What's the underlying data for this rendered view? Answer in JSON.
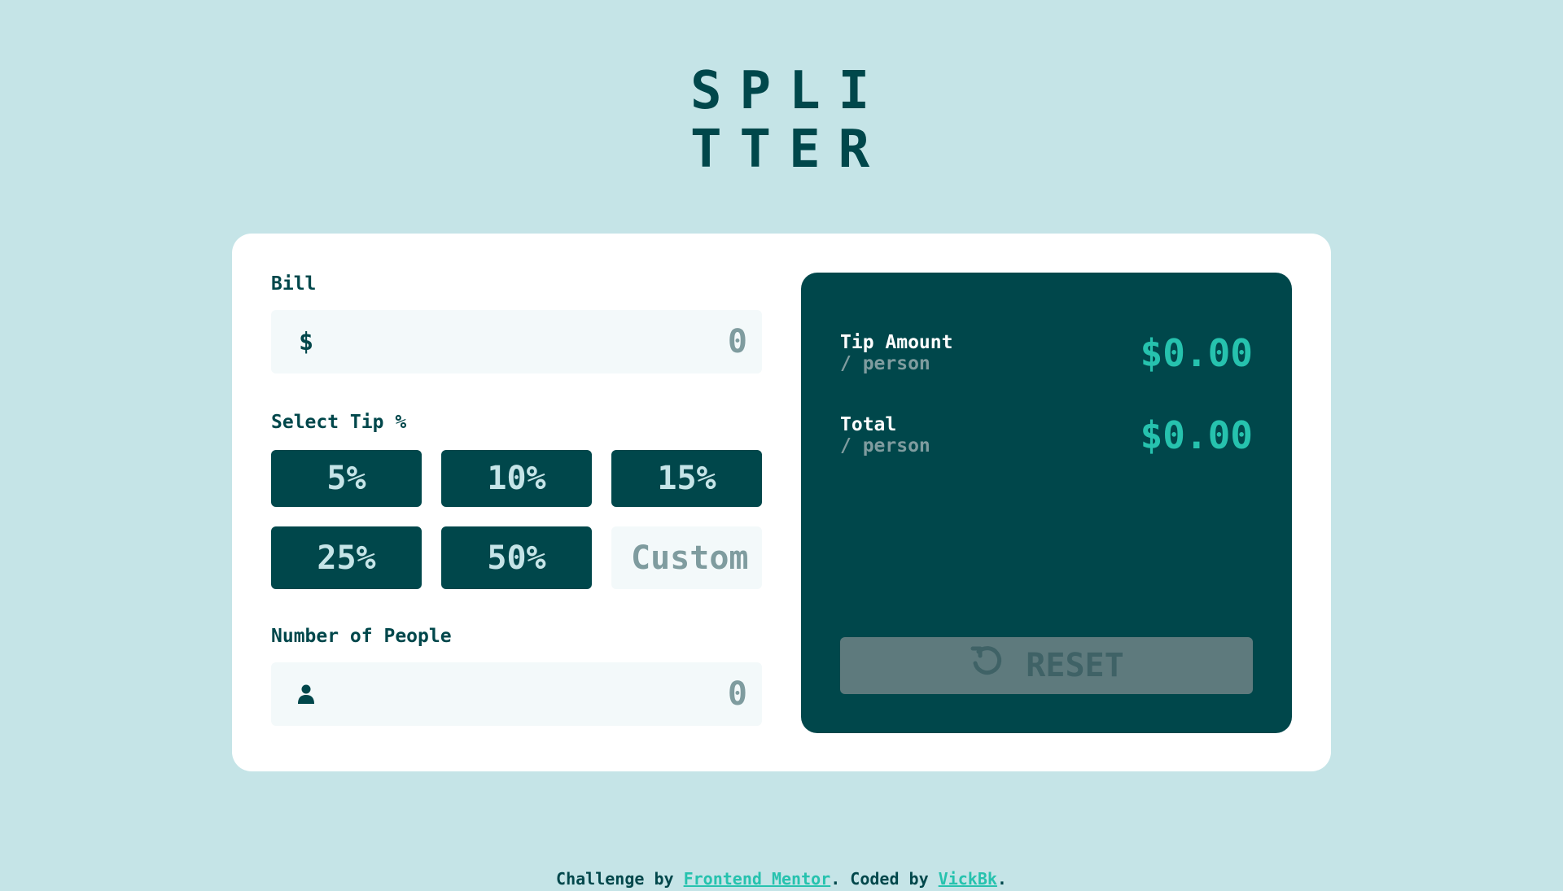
{
  "logo": {
    "line1": "SPLI",
    "line2": "TTER"
  },
  "form": {
    "bill_label": "Bill",
    "bill_prefix": "$",
    "bill_placeholder": "0",
    "tip_label": "Select Tip %",
    "tips": [
      "5%",
      "10%",
      "15%",
      "25%",
      "50%"
    ],
    "custom_placeholder": "Custom",
    "people_label": "Number of People",
    "people_placeholder": "0"
  },
  "results": {
    "tip_title": "Tip Amount",
    "tip_sub": "/ person",
    "tip_value": "$0.00",
    "total_title": "Total",
    "total_sub": "/ person",
    "total_value": "$0.00",
    "reset_label": "RESET"
  },
  "footer": {
    "prefix": "Challenge by ",
    "link1": "Frontend Mentor",
    "mid": ". Coded by ",
    "link2": "VickBk",
    "suffix": "."
  },
  "colors": {
    "background": "#c5e4e7",
    "primary": "#00474b",
    "accent": "#26c2ae",
    "input_bg": "#f3f9fa",
    "muted": "#7f9c9f"
  },
  "icons": {
    "people": "person-icon",
    "reset": "reset-icon"
  }
}
